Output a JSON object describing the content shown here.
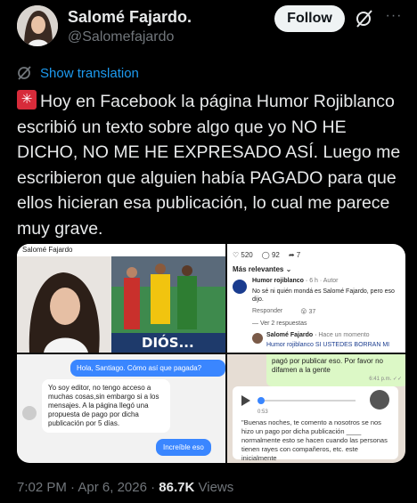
{
  "author": {
    "name": "Salomé Fajardo.",
    "handle": "@Salomefajardo"
  },
  "header": {
    "follow_label": "Follow",
    "more_label": "···"
  },
  "translate_label": "Show translation",
  "tweet_text": "Hoy en Facebook la página Humor Rojiblanco escribió un texto sobre algo que yo NO HE DICHO, NO ME HE EXPRESADO ASÍ. Luego me escribieron que alguien había PAGADO para que ellos hicieran esa publicación, lo cual me parece muy grave.",
  "media": {
    "panel1": {
      "header": "Salomé Fajardo",
      "banner": "DIÓS..."
    },
    "panel2": {
      "reactions": "520",
      "comments": "92",
      "shares": "7",
      "sort": "Más relevantes",
      "commenter": "Humor rojiblanco",
      "commenter_meta": "6 h · Autor",
      "comment": "No sé ni quién mondá es Salomé Fajardo, pero eso dijo.",
      "reply_label": "Responder",
      "reply_likes": "37",
      "view_replies": "Ver 2 respuestas",
      "replier": "Salomé Fajardo",
      "replier_meta": "Hace un momento",
      "reply_text": "Humor rojiblanco SI USTEDES BORRAN MI"
    },
    "panel3": {
      "msg_out": "Hola, Santiago. Cómo así que pagada?",
      "msg_in": "Yo soy editor, no tengo acceso a muchas cosas,sin embargo si a los mensajes. A la página llegó una propuesta de pago por dicha publicación por 5 días.",
      "msg_out2": "Increíble eso"
    },
    "panel4": {
      "msg_top": "pagó por publicar eso. Por favor no difamen a la gente",
      "time_top": "6:41 p.m.",
      "voice_time": "0:53",
      "msg_quote": "\"Buenas noches, te comento a nosotros se nos hizo un pago por dicha publicación ____ normalmente esto se hacen cuando las personas tienen rayes con compañeros, etc. este inicialmente"
    }
  },
  "meta": {
    "time": "7:02 PM",
    "date": "Apr 6, 2026",
    "views": "86.7K",
    "views_label": "Views"
  },
  "colors": {
    "accent": "#1d9bf0",
    "muted": "#71767b"
  }
}
